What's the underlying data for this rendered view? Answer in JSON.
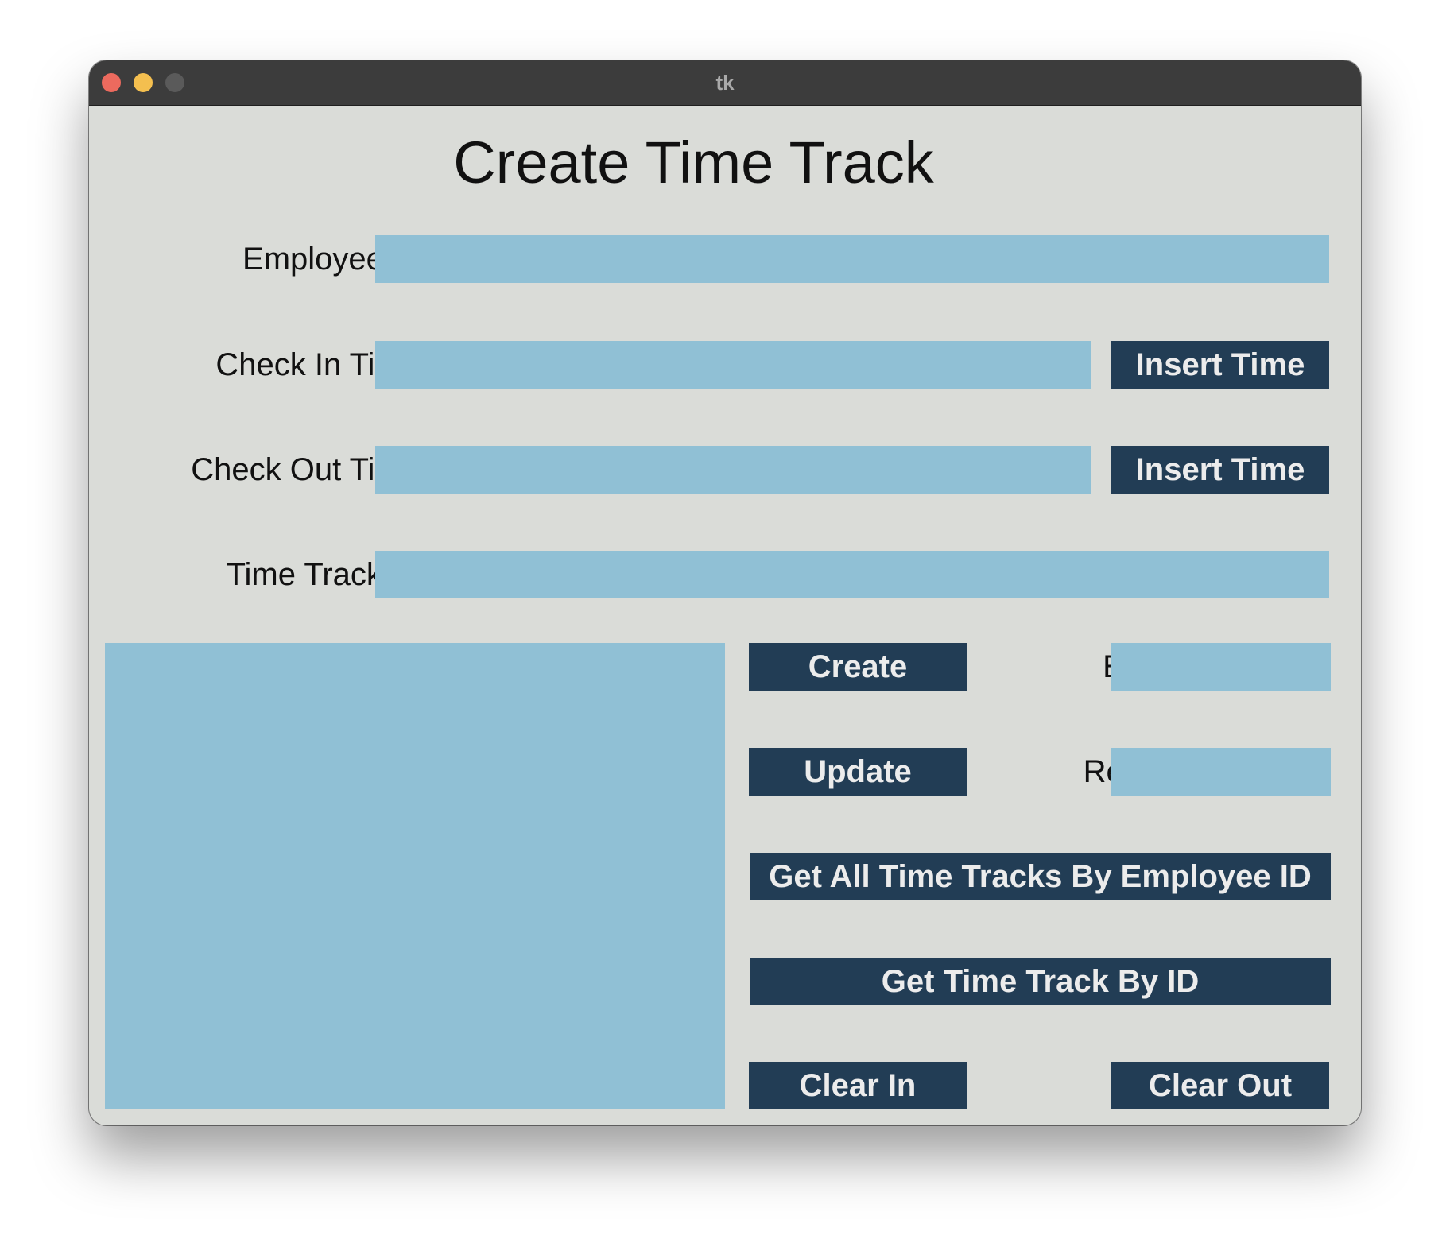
{
  "window": {
    "title": "tk"
  },
  "form": {
    "heading": "Create Time Track",
    "employee_id_label": "Employee ID",
    "employee_id_value": "",
    "check_in_label": "Check In Time",
    "check_in_value": "",
    "check_out_label": "Check Out Time",
    "check_out_value": "",
    "time_track_id_label": "Time Track ID",
    "time_track_id_value": ""
  },
  "buttons": {
    "insert_time_in": "Insert Time",
    "insert_time_out": "Insert Time",
    "create": "Create",
    "update": "Update",
    "get_all_by_employee": "Get All Time Tracks By Employee ID",
    "get_by_id": "Get Time Track By ID",
    "clear_in": "Clear In",
    "clear_out": "Clear Out"
  },
  "status": {
    "error_label": "Error",
    "error_value": "",
    "result_label": "Result",
    "result_value": ""
  },
  "colors": {
    "window_bg": "#dadcd8",
    "field_bg": "#90c0d5",
    "button_bg": "#223d55",
    "button_text": "#ececec",
    "titlebar": "#3c3c3c"
  }
}
